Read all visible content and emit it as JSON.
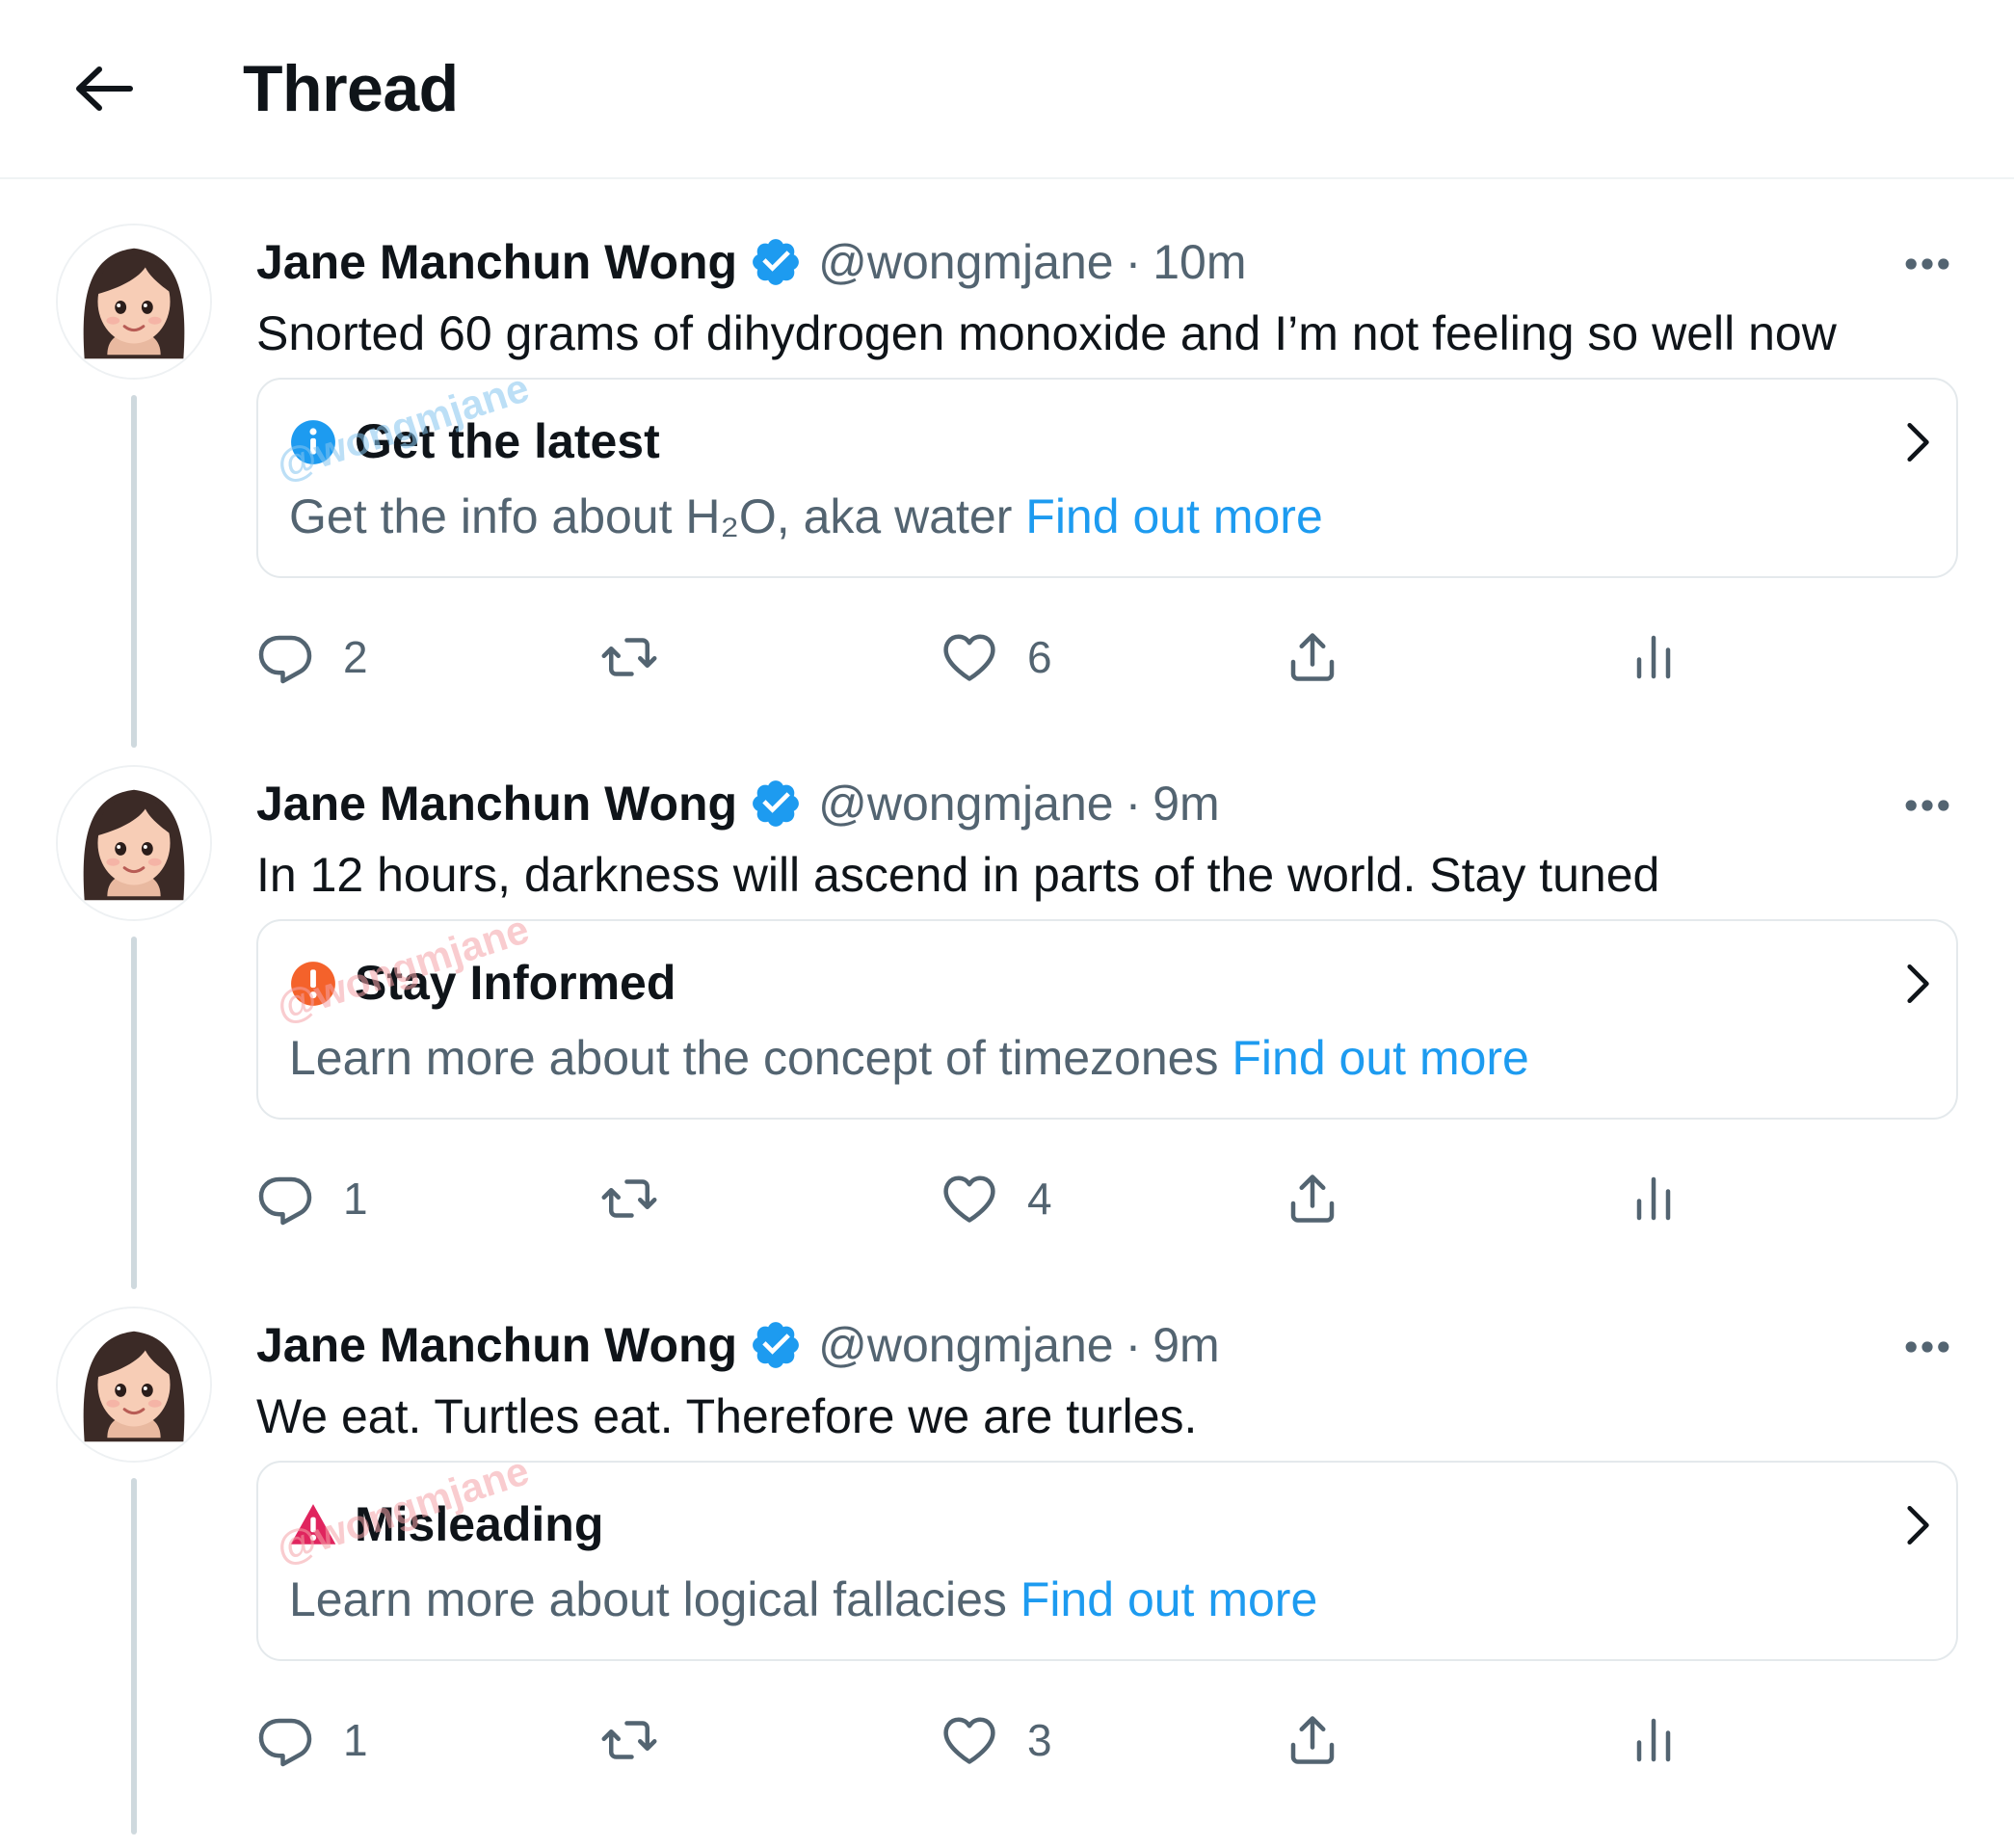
{
  "header": {
    "title": "Thread",
    "back_icon": "arrow-left-icon"
  },
  "colors": {
    "link": "#1d9bf0",
    "secondary_text": "#536471",
    "verified": "#1d9bf0",
    "info_badge": "#1d9bf0",
    "warning_badge": "#f4622b",
    "misleading_badge": "#e0245e",
    "watermark_blue": "#86c6f0",
    "watermark_pink": "#f5a3a8"
  },
  "tweets": [
    {
      "author": "Jane Manchun Wong",
      "handle": "@wongmjane",
      "separator": "·",
      "time": "10m",
      "text": "Snorted 60 grams of dihydrogen monoxide and I’m not feeling so well now",
      "notice": {
        "icon": "info-icon",
        "title": "Get the latest",
        "body": "Get the info about H₂O, aka water",
        "link": "Find out more",
        "watermark": "@wongmjane"
      },
      "replies": "2",
      "likes": "6"
    },
    {
      "author": "Jane Manchun Wong",
      "handle": "@wongmjane",
      "separator": "·",
      "time": "9m",
      "text": "In 12 hours, darkness will ascend in parts of the world. Stay tuned",
      "notice": {
        "icon": "exclamation-icon",
        "title": "Stay Informed",
        "body": "Learn more about the concept of timezones",
        "link": "Find out more",
        "watermark": "@wongmjane"
      },
      "replies": "1",
      "likes": "4"
    },
    {
      "author": "Jane Manchun Wong",
      "handle": "@wongmjane",
      "separator": "·",
      "time": "9m",
      "text": "We eat. Turtles eat. Therefore we are turles.",
      "notice": {
        "icon": "warning-triangle-icon",
        "title": "Misleading",
        "body": "Learn more about logical fallacies",
        "link": "Find out more",
        "watermark": "@wongmjane"
      },
      "replies": "1",
      "likes": "3"
    }
  ]
}
